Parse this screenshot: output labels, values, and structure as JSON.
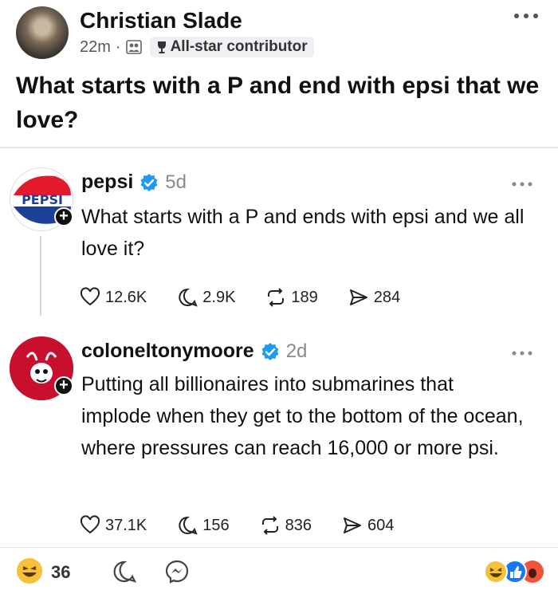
{
  "post": {
    "author": "Christian Slade",
    "time": "22m",
    "separator": "·",
    "badge": "All-star contributor",
    "text": "What starts with a P and end with epsi that we love?"
  },
  "threads": [
    {
      "handle": "pepsi",
      "time": "5d",
      "text": "What starts with a P and ends with epsi and we all love it?",
      "likes": "12.6K",
      "comments": "2.9K",
      "reposts": "189",
      "shares": "284",
      "logo_text": "PEPSI"
    },
    {
      "handle": "coloneltonymoore",
      "time": "2d",
      "text": "Putting all billionaires into submarines that implode when they get to the bottom of the ocean, where pressures can reach 16,000 or more psi.",
      "likes": "37.1K",
      "comments": "156",
      "reposts": "836",
      "shares": "604"
    }
  ],
  "footer": {
    "reaction_count": "36"
  },
  "colors": {
    "verified": "#1d9bf0",
    "pepsi_red": "#e21a2c",
    "pepsi_blue": "#1d3f97",
    "haha_yellow": "#f7c23a"
  },
  "icons": {
    "like": "heart-icon",
    "comment": "speech-bubble-icon",
    "repost": "repost-icon",
    "share": "send-icon",
    "more": "more-dots-icon",
    "verified": "verified-check-icon"
  }
}
